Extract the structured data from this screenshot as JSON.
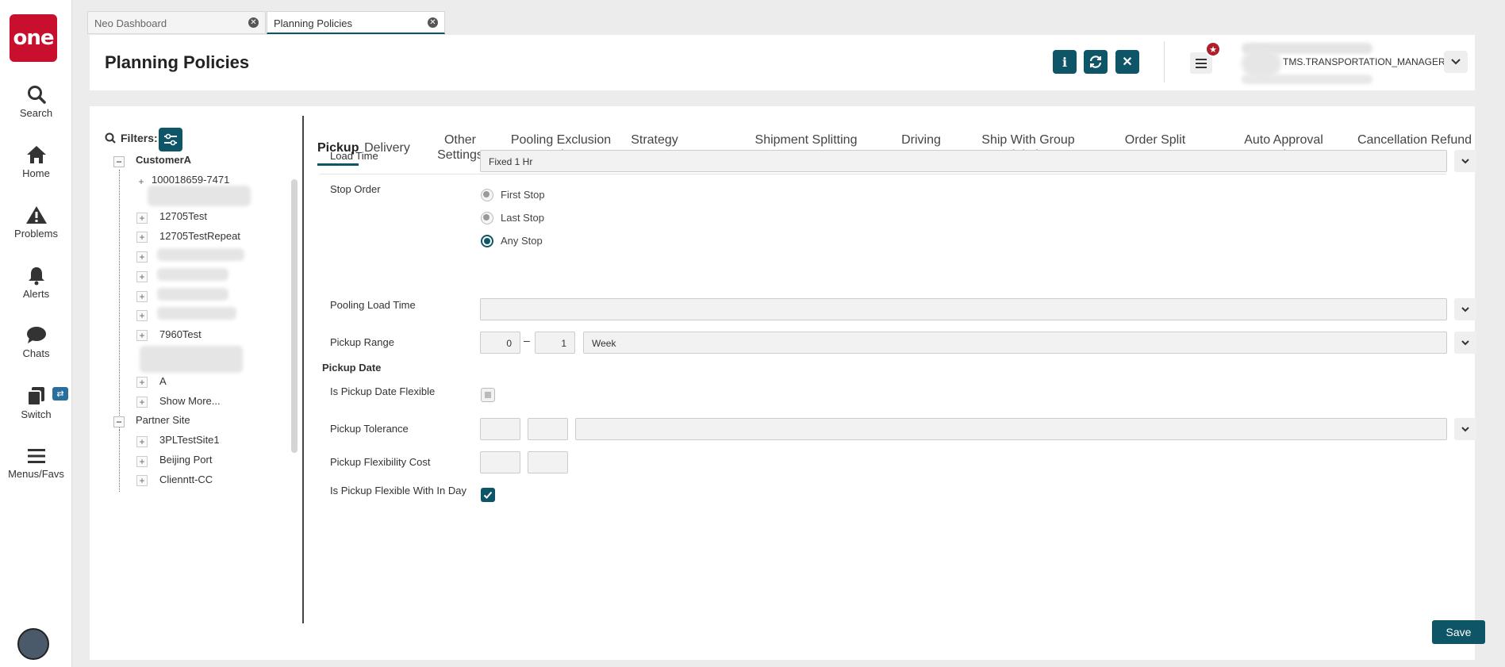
{
  "nav": {
    "logo": "one",
    "items": [
      {
        "label": "Search",
        "icon": "search-icon"
      },
      {
        "label": "Home",
        "icon": "home-icon"
      },
      {
        "label": "Problems",
        "icon": "warning-icon"
      },
      {
        "label": "Alerts",
        "icon": "bell-icon"
      },
      {
        "label": "Chats",
        "icon": "chat-icon"
      },
      {
        "label": "Switch",
        "icon": "switch-icon"
      },
      {
        "label": "Menus/Favs",
        "icon": "menu-icon"
      }
    ]
  },
  "tabs": [
    {
      "label": "Neo Dashboard",
      "active": false
    },
    {
      "label": "Planning Policies",
      "active": true
    }
  ],
  "header": {
    "title": "Planning Policies",
    "user_role": "TMS.TRANSPORTATION_MANAGER",
    "accent": "#0e5567"
  },
  "filters": {
    "label": "Filters:"
  },
  "tree": {
    "customer_label": "CustomerA",
    "customer_children": [
      "100018659-7471",
      "12705Test",
      "12705TestRepeat",
      "7960Test",
      "A"
    ],
    "show_more": "Show More...",
    "partner_label": "Partner Site",
    "partner_children": [
      "3PLTestSite1",
      "Beijing Port",
      "Clienntt-CC"
    ]
  },
  "policy_tabs": [
    "Pickup",
    "Delivery",
    "Other Settings",
    "Pooling Exclusion Rules",
    "Strategy Parameters",
    "Shipment Splitting Parameters",
    "Driving Laws",
    "Ship With Group Violation",
    "Order Split Parameters",
    "Auto Approval Settings",
    "Cancellation Refund Rate"
  ],
  "form": {
    "load_time_label": "Load Time",
    "load_time_value": "Fixed 1 Hr",
    "stop_order_label": "Stop Order",
    "stop_order_options": [
      "First Stop",
      "Last Stop",
      "Any Stop"
    ],
    "stop_order_selected": "Any Stop",
    "pooling_load_time_label": "Pooling Load Time",
    "pooling_load_time_value": "",
    "pickup_range_label": "Pickup Range",
    "pickup_range_from": "0",
    "pickup_range_to": "1",
    "pickup_range_unit": "Week",
    "pickup_date_section": "Pickup Date",
    "is_pickup_date_flexible_label": "Is Pickup Date Flexible",
    "is_pickup_date_flexible": false,
    "pickup_tolerance_label": "Pickup Tolerance",
    "pickup_flexibility_cost_label": "Pickup Flexibility Cost",
    "is_pickup_flexible_in_day_label": "Is Pickup Flexible With In Day",
    "is_pickup_flexible_in_day": true
  },
  "save_label": "Save",
  "range_dash": "–"
}
